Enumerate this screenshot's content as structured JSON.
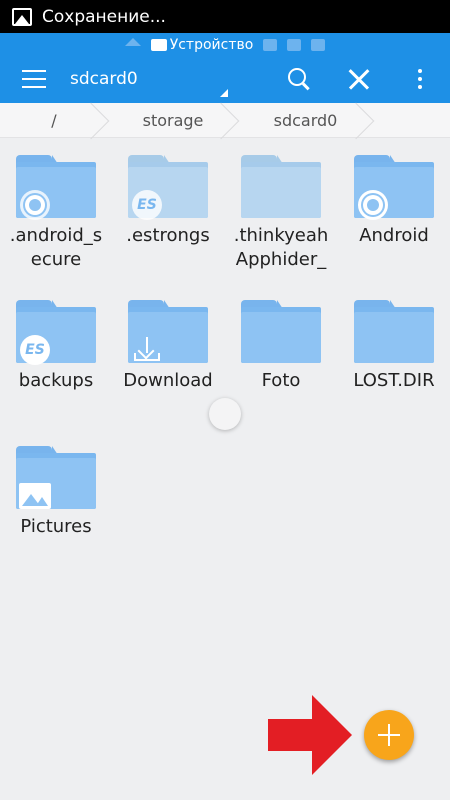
{
  "status_bar": {
    "title": "Сохранение..."
  },
  "window_strip": {
    "active_label": "Устройство"
  },
  "toolbar": {
    "path_title": "sdcard0"
  },
  "breadcrumb": [
    "/",
    "storage",
    "sdcard0"
  ],
  "files": [
    {
      "name": ".android_s ecure",
      "badge": "gear-icon",
      "pale": false
    },
    {
      "name": ".estrongs",
      "badge": "es-icon",
      "pale": true
    },
    {
      "name": ".thinkyeah Apphider_",
      "badge": "",
      "pale": true
    },
    {
      "name": "Android",
      "badge": "gear-icon",
      "pale": false
    },
    {
      "name": "backups",
      "badge": "es-icon",
      "pale": false
    },
    {
      "name": "Download",
      "badge": "download-icon",
      "pale": false
    },
    {
      "name": "Foto",
      "badge": "",
      "pale": false
    },
    {
      "name": "LOST.DIR",
      "badge": "",
      "pale": false
    },
    {
      "name": "Pictures",
      "badge": "image-icon",
      "pale": false
    }
  ],
  "colors": {
    "app_bar": "#1e90e6",
    "fab": "#f8a51b",
    "arrow": "#e31e24",
    "folder": "#8ec3f3"
  }
}
